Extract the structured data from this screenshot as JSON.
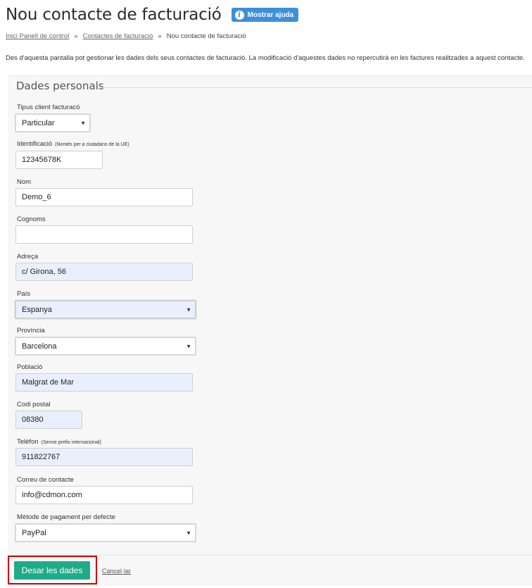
{
  "header": {
    "title": "Nou contacte de facturació",
    "help_label": "Mostrar ajuda",
    "help_icon": "i"
  },
  "breadcrumb": {
    "items": [
      "Inici Panell de control",
      "Contactes de facturació",
      "Nou contacte de facturació"
    ],
    "separator": "»"
  },
  "description": "Des d'aquesta pantalla pot gestionar les dades dels seus contactes de facturació. La modificació d'aquestes dades no repercutirà en les factures realitzades a aquest contacte.",
  "form": {
    "section_title": "Dades personals",
    "client_type": {
      "label": "Tipus client facturacó",
      "value": "Particular"
    },
    "identification": {
      "label": "Identificació",
      "note": "(Només per a ciutadans de la UE)",
      "value": "12345678K"
    },
    "name": {
      "label": "Nom",
      "value": "Demo_6"
    },
    "surnames": {
      "label": "Cognoms",
      "value": ""
    },
    "address": {
      "label": "Adreça",
      "value": "c/ Girona, 56"
    },
    "country": {
      "label": "País",
      "value": "Espanya"
    },
    "province": {
      "label": "Província",
      "value": "Barcelona"
    },
    "city": {
      "label": "Població",
      "value": "Malgrat de Mar"
    },
    "postal_code": {
      "label": "Codi postal",
      "value": "08380"
    },
    "phone": {
      "label": "Telèfon",
      "note": "(Sense prefix internacional)",
      "value": "911822767"
    },
    "email": {
      "label": "Correu de contacte",
      "value": "info@cdmon.com"
    },
    "payment_method": {
      "label": "Mètode de pagament per defecte",
      "value": "PayPal"
    },
    "caret": "▼"
  },
  "actions": {
    "save_label": "Desar les dades",
    "cancel_label": "Cancel·lar"
  },
  "colors": {
    "primary_button": "#1fab89",
    "help_button": "#3d8fd8",
    "autofill_bg": "#e8f0fe",
    "highlight": "#d40000"
  }
}
